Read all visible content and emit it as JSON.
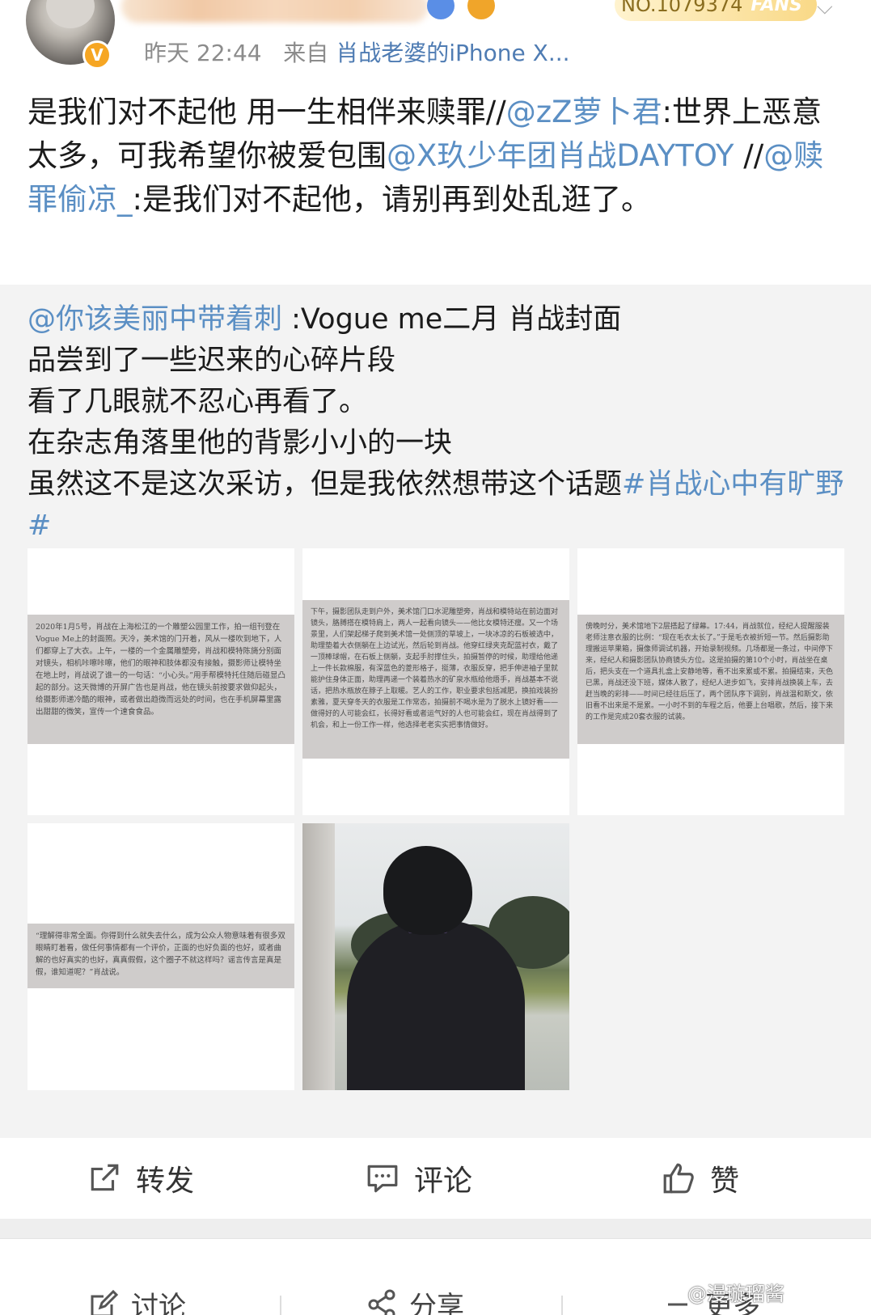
{
  "header": {
    "fans_number": "NO.1079374",
    "fans_tag": "FANS",
    "time": "昨天 22:44",
    "from_label": "来自",
    "source": "肖战老婆的iPhone X..."
  },
  "post": {
    "t1": "是我们对不起他 用一生相伴来赎罪//",
    "m1": "@zZ萝卜君",
    "t2": ":世界上恶意太多，可我希望你被爱包围",
    "m2": "@X玖少年团肖战DAYTOY",
    "t3": " //",
    "m3": "@赎罪偷凉_",
    "t4": ":是我们对不起他，请别再到处乱逛了。"
  },
  "quote": {
    "mention": "@你该美丽中带着刺",
    "line1": " :Vogue me二月 肖战封面",
    "line2": "品尝到了一些迟来的心碎片段",
    "line3": "看了几眼就不忍心再看了。",
    "line4": "在杂志角落里他的背影小小的一块",
    "line5": "虽然这不是这次采访，但是我依然想带这个话题",
    "topic": "#肖战心中有旷野#"
  },
  "scans": {
    "s1": "2020年1月5号，肖战在上海松江的一个雕塑公园里工作，拍一组刊登在Vogue Me上的封面照。天冷，美术馆的门开着，风从一楼吹到地下，人们都穿上了大衣。上午，一楼的一个金属雕塑旁，肖战和模特陈旖分别面对镜头，相机咔嚓咔嚓，他们的眼神和肢体都没有接触，摄影师让模特坐在地上时，肖战说了谁一的一句话：“小心头。”用手帮模特托住随后碰显凸起的部分。这天微博的开屏广告也是肖战，他在镜头前按要求做仰起头，给摄影师递冷酷的眼神，或者做出趋微而远处的时间，也在手机屏幕里露出甜甜的微笑，宣传一个速食食品。",
    "s2": "下午，摄影团队走到户外，美术馆门口水泥雕塑旁，肖战和模特站在前边面对镜头，胳膊搭在模特肩上，两人一起看向镜头——他比女模特还瘦。又一个场景里，人们架起梯子爬到美术馆一处侧顶的草坡上，一块冰凉的石板被选中，助理垫着大衣侧躺在上边试光，然后轮到肖战。他穿红绿夹克配蓝衬衣，戴了一顶棒球帽，在石板上侧躺，支起手肘撑住头，拍摄暂停的时候，助理给他递上一件长款棉服，有深蓝色的菱形格子，挺薄，衣服反穿，把手伸进袖子里就能护住身体正面，助理再递一个装着热水的矿泉水瓶给他焐手，肖战基本不说话，把热水瓶放在脖子上取暖。艺人的工作，职业要求包括减肥，换拍戏装扮素雅，夏天穿冬天的衣服是工作常态，拍摄前不喝水是为了脱水上镜好看——做得好的人可能会红，长得好看或者运气好的人也可能会红，现在肖战得到了机会，和上一份工作一样，他选择老老实实把事情做好。",
    "s3": "傍晚时分，美术馆地下2层搭起了绿幕。17:44，肖战就位，经纪人提醒服装老师注意衣服的比例：“现在毛衣太长了。”于是毛衣被折短一节。然后摄影助理搬运苹果箱，摄像师调试机器，开始录制视频。几场都是一条过，中间停下来，经纪人和摄影团队协商镜头方位。这是拍摄的第10个小时，肖战坐在桌后，把头支在一个道具扎盒上安静地等，看不出来累或不累。拍摄结束，天色已黑，肖战还没下班，媒体人散了，经纪人进步如飞，安排肖战换装上车，去赶当晚的彩排——时间已经往后压了，两个团队序下调别，肖战温和斯文，依旧看不出来是不是累。一小时不到的车程之后，他要上台唱歌，然后，接下来的工作是完成20套衣服的试装。",
    "s4": "“理解得非常全面。你得到什么就失去什么，成为公众人物意味着有很多双眼睛盯着看，做任何事情都有一个评价，正面的也好负面的也好，或者曲解的也好真实的也好，真真假假，这个圈子不就这样吗？谣言传言是真是假，谁知道呢？”肖战说。"
  },
  "actions": {
    "repost": "转发",
    "comment": "评论",
    "like": "赞"
  },
  "bottom": {
    "discuss": "讨论",
    "share": "分享",
    "more": "更多"
  },
  "watermark": "@漫璇瑠酱"
}
